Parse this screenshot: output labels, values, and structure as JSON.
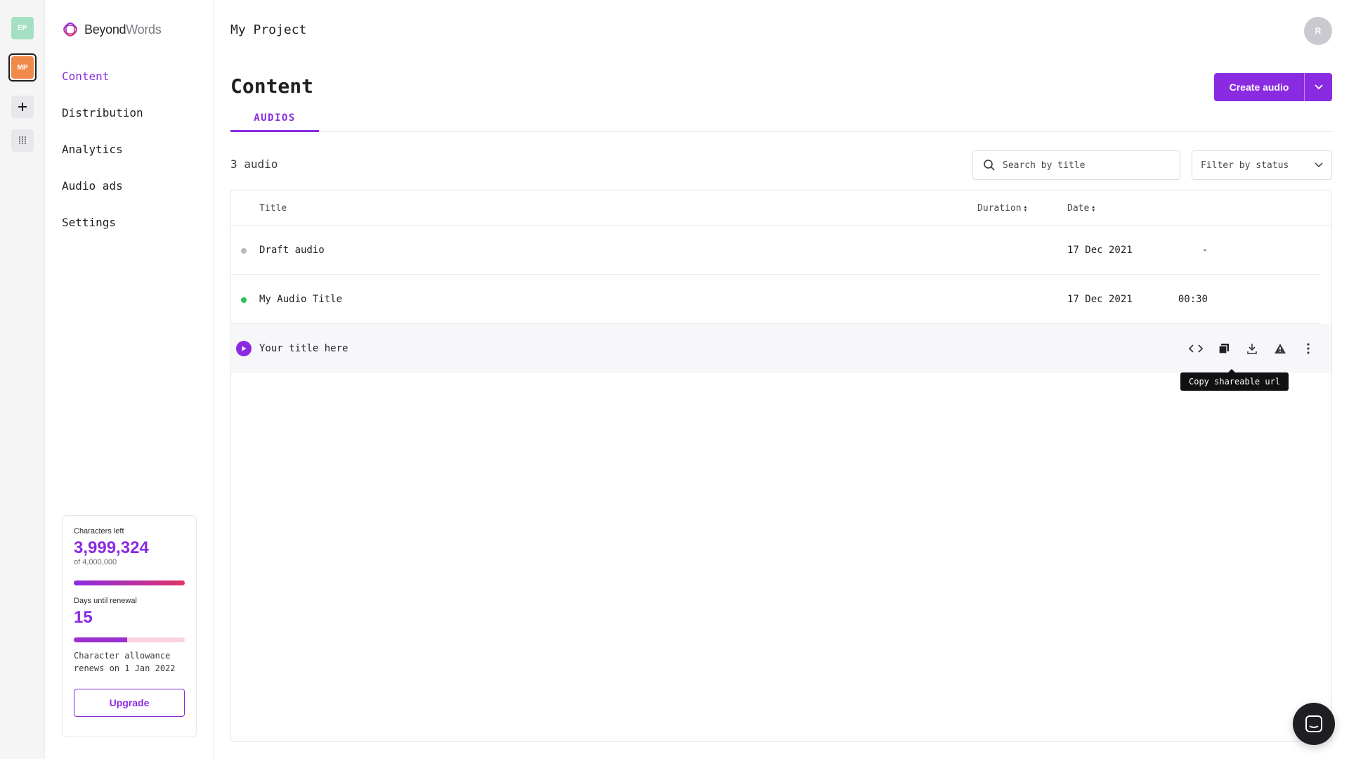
{
  "workspaces": {
    "items": [
      {
        "initials": "EP",
        "color": "#a6e0c4"
      },
      {
        "initials": "MP",
        "color": "#f08a4b",
        "active": true
      }
    ],
    "add_icon": "plus-icon",
    "apps_icon": "grid-icon"
  },
  "brand": {
    "name_part1": "Beyond",
    "name_part2": "Words",
    "logo_icon": "beyondwords-logo-icon"
  },
  "nav": {
    "items": [
      {
        "label": "Content",
        "active": true
      },
      {
        "label": "Distribution"
      },
      {
        "label": "Analytics"
      },
      {
        "label": "Audio ads"
      },
      {
        "label": "Settings"
      }
    ]
  },
  "usage": {
    "characters_label": "Characters left",
    "characters_left": "3,999,324",
    "characters_total": "of 4,000,000",
    "characters_fraction": 0.9998,
    "days_label": "Days until renewal",
    "days_left": "15",
    "days_fraction": 0.48,
    "renewal_note": "Character allowance renews on 1 Jan 2022",
    "upgrade_label": "Upgrade"
  },
  "header": {
    "project": "My Project",
    "avatar_initial": "R"
  },
  "page": {
    "title": "Content",
    "create_label": "Create audio",
    "tab_label": "AUDIOS",
    "count": "3 audio",
    "search_placeholder": "Search by title",
    "filter_placeholder": "Filter by status"
  },
  "table": {
    "columns": {
      "title": "Title",
      "duration": "Duration",
      "date": "Date"
    },
    "rows": [
      {
        "status": "draft",
        "status_color": "#b8b8bf",
        "title": "Draft audio",
        "duration": "-",
        "date": "17 Dec 2021"
      },
      {
        "status": "published",
        "status_color": "#2cc35a",
        "title": "My Audio Title",
        "duration": "00:30",
        "date": "17 Dec 2021"
      },
      {
        "status": "playable",
        "title": "Your title here",
        "duration": "",
        "date": ""
      }
    ],
    "row_actions": [
      "code-embed-icon",
      "copy-icon",
      "download-icon",
      "warning-icon",
      "more-vertical-icon"
    ]
  },
  "tooltip": {
    "text": "Copy shareable url"
  },
  "colors": {
    "accent": "#8a2be2",
    "text": "#1f1f23"
  }
}
